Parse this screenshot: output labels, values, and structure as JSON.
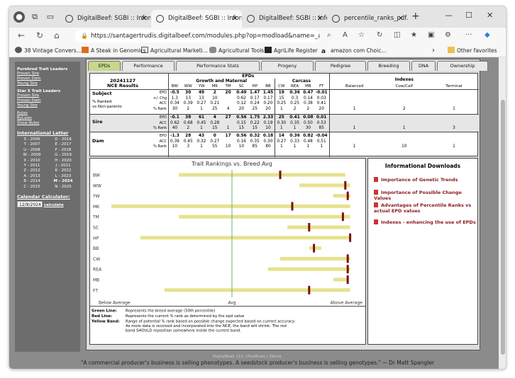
{
  "browser": {
    "tabs": [
      {
        "label": "DigitalBeef: SGBI :: Inform"
      },
      {
        "label": "DigitalBeef: SGBI :: Inform"
      },
      {
        "label": "DigitalBeef: SGBI :: Inform"
      },
      {
        "label": "percentile_ranks_pdf.php"
      }
    ],
    "url": "https://santagertrudis.digitalbeef.com/modules.php?op=modload&name=_ani...",
    "bookmarks": [
      "38 Vintage Convers...",
      "A Steak in Genomics",
      "Agricultural Marketi...",
      "Agricultural Tools",
      "AgriLife Register",
      "amazon com Choic...",
      "Other favorites"
    ]
  },
  "sidebar": {
    "sec1_title": "Purebred Trait Leaders",
    "sec1_links": [
      "Proven Sire",
      "Proven Dam",
      "Young Sire"
    ],
    "sec2_title": "Star 5 Trait Leaders",
    "sec2_links": [
      "Proven Sire",
      "Proven Dam",
      "Young Sire"
    ],
    "sec3_links": [
      "Rules",
      "ByLaws",
      "Show Rules"
    ],
    "letter_title": "International Letter",
    "letters": [
      "S - 2006",
      "D - 2016",
      "T - 2007",
      "E - 2017",
      "U - 2008",
      "F - 2018",
      "W - 2009",
      "G - 2019",
      "X - 2010",
      "H - 2020",
      "Y - 2011",
      "J - 2021",
      "Z - 2012",
      "K - 2022",
      "A - 2013",
      "L - 2023",
      "B - 2014",
      "M - 2024",
      "C - 2015",
      "N - 2025"
    ],
    "calc_title": "Calendar Calculator:",
    "calc_value": "12/9/2024",
    "calc_button": "calculate"
  },
  "page_tabs": [
    "EPDs",
    "Performance",
    "Performance Stats",
    "Progeny",
    "Pedigree",
    "Breeding",
    "DNA",
    "Ownership"
  ],
  "epd": {
    "date": "20241127",
    "subtitle": "NCE Results",
    "title": "EPDs",
    "group_gm": "Growth and Maternal",
    "group_carcass": "Carcass",
    "group_index": "Indexes",
    "cols": [
      "BW",
      "WW",
      "YW",
      "MK",
      "TM",
      "SC",
      "HP",
      "BB",
      "CW",
      "REA",
      "MB",
      "FT"
    ],
    "index_cols": [
      "Balanced",
      "Cow/Calf",
      "Terminal"
    ],
    "subject_label": "Subject",
    "subject_sub": [
      "% Ranked",
      "vs Non-parents"
    ],
    "rowlabels_subject": [
      "EPD",
      "+/- Chg",
      "ACC",
      "% Rank"
    ],
    "rowlabels": [
      "EPD",
      "ACC",
      "% Rank"
    ],
    "subject": {
      "epd": [
        "-0.5",
        "30",
        "49",
        "2",
        "20",
        "0.49",
        "1.47",
        "1.45",
        "19",
        "0.36",
        "0.47",
        "-0.01"
      ],
      "chg": [
        "1.3",
        "13",
        "13",
        "10",
        "",
        "0.62",
        "0.17",
        "0.17",
        "15",
        "0.3",
        "0.14",
        "0.03"
      ],
      "acc": [
        "0.34",
        "0.39",
        "0.27",
        "0.21",
        "",
        "0.12",
        "0.24",
        "0.20",
        "0.25",
        "0.25",
        "0.38",
        "0.41"
      ],
      "rank": [
        "30",
        "2",
        "1",
        "25",
        "4",
        "20",
        "25",
        "20",
        "1",
        "2",
        "2",
        "20"
      ],
      "idx": [
        "1",
        "2",
        "1"
      ]
    },
    "sire_label": "Sire",
    "sire": {
      "epd": [
        "-0.1",
        "38",
        "61",
        "4",
        "27",
        "0.56",
        "1.75",
        "2.33",
        "25",
        "0.41",
        "0.08",
        "0.01"
      ],
      "acc": [
        "0.62",
        "0.68",
        "0.45",
        "0.28",
        "",
        "0.15",
        "0.22",
        "0.19",
        "0.30",
        "0.35",
        "0.50",
        "0.53"
      ],
      "rank": [
        "40",
        "2",
        "1",
        "15",
        "1",
        "15",
        "15",
        "10",
        "1",
        "1",
        "30",
        "85"
      ],
      "idx": [
        "1",
        "1",
        "3"
      ]
    },
    "dam_label": "Dam",
    "dam": {
      "epd": [
        "-1.3",
        "28",
        "43",
        "0",
        "17",
        "0.56",
        "0.32",
        "0.18",
        "14",
        "0.36",
        "0.82",
        "-0.04"
      ],
      "acc": [
        "0.39",
        "0.45",
        "0.32",
        "0.27",
        "",
        "0.16",
        "0.35",
        "0.30",
        "0.27",
        "0.33",
        "0.48",
        "0.51"
      ],
      "rank": [
        "10",
        "3",
        "1",
        "55",
        "10",
        "10",
        "85",
        "80",
        "1",
        "1",
        "1",
        "1"
      ],
      "idx": [
        "1",
        "10",
        "1"
      ]
    }
  },
  "chart_data": {
    "type": "bar",
    "title": "Trait Rankings vs. Breed Avg",
    "categories": [
      "BW",
      "WW",
      "YW",
      "MK",
      "TM",
      "SC",
      "HP",
      "BB",
      "CW",
      "REA",
      "MB",
      "FT"
    ],
    "xlabels": [
      "Below Average",
      "Avg",
      "Above Average"
    ],
    "band_start": [
      0.28,
      0.78,
      0.92,
      0.0,
      0.28,
      0.73,
      0.12,
      0.82,
      0.7,
      0.65,
      0.92,
      0.22
    ],
    "band_end": [
      0.97,
      0.99,
      0.99,
      0.99,
      0.99,
      0.99,
      0.99,
      0.87,
      0.99,
      0.99,
      0.98,
      0.99
    ],
    "rank_marker": [
      0.7,
      0.97,
      0.98,
      0.75,
      0.96,
      0.82,
      0.99,
      0.84,
      0.98,
      0.98,
      0.98,
      0.82
    ],
    "breed_avg": 0.5,
    "band_color": "#e6e28c",
    "rank_color": "#7a1010",
    "avg_color": "#6cb36c"
  },
  "legend": [
    {
      "key": "Green Line:",
      "text": "Represents the breed average (50th percentile)"
    },
    {
      "key": "Red Line:",
      "text": "Represents the current % rank as determined by the epd value"
    },
    {
      "key": "Yellow Band:",
      "text": "Range of potential % rank based on possible change expected based on current accuracy. As more data is received and incorporated into the NCE, the band will shrink. The red band SHOULD reposition somewhere inside the current band."
    }
  ],
  "downloads": {
    "title": "Informational Downloads",
    "items": [
      "Importance of Genetic Trends",
      "Importance of Possible Change Values",
      "Advantages of Percentile Ranks vs actual EPD values",
      "Indexes - enhancing the use of EPDs"
    ]
  },
  "footer": "DigitalBeef, LLC | PostNuke | Zikula",
  "quote": "\"A commercial producer's business is selling phenotypes. A seedstock producer's business is selling genotypes.\" ~ Dr Matt Spangler"
}
